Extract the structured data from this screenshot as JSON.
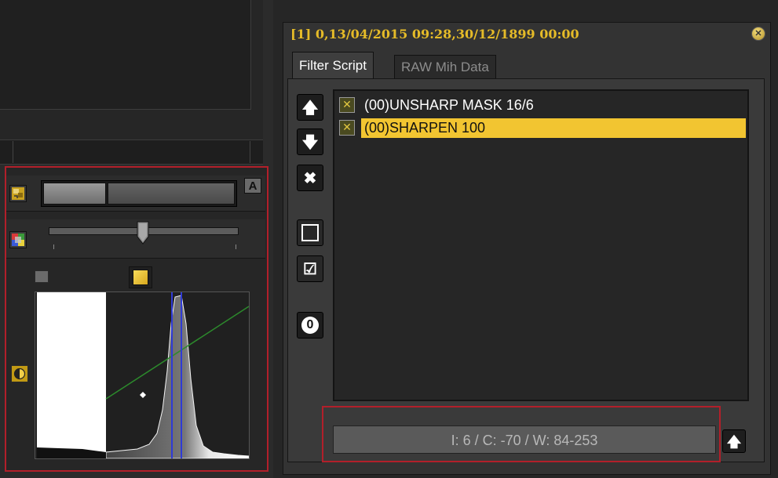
{
  "colors": {
    "accent_gold": "#f2c531",
    "title_gold": "#e5bb28",
    "highlight_red": "#b21f2a",
    "panel_bg": "#333333"
  },
  "left_panel": {
    "mode_button_label": "A",
    "slider_level": 0.5,
    "icons": [
      "selection-icon",
      "color-balance-icon",
      "circle-icon",
      "square-icon",
      "contrast-icon"
    ],
    "histogram": {
      "curve_color": "#2c8a2c",
      "marker_color": "#2f3bd6"
    }
  },
  "dialog": {
    "title": "[1] 0,13/04/2015 09:28,30/12/1899 00:00",
    "close_icon": "close-icon",
    "tabs": [
      {
        "label": "Filter Script",
        "active": true
      },
      {
        "label": "RAW Mih Data",
        "active": false
      }
    ],
    "side_buttons": [
      "move-up-icon",
      "move-down-icon",
      "delete-icon",
      "uncheck-all-icon",
      "check-all-icon",
      "reset-icon"
    ],
    "reset_label": "0",
    "filters": [
      {
        "label": "(00)UNSHARP MASK 16/6",
        "checked": true,
        "selected": false
      },
      {
        "label": "(00)SHARPEN 100",
        "checked": true,
        "selected": true
      }
    ],
    "status": "I: 6 / C: -70 / W: 84-253"
  }
}
